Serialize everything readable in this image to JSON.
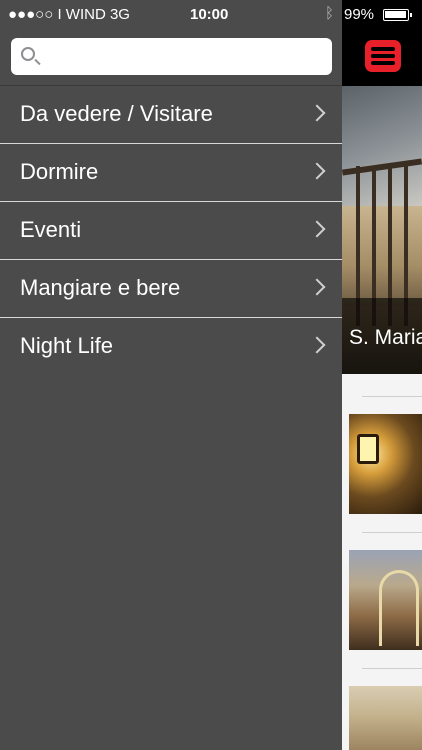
{
  "status_bar": {
    "carrier": "●●●○○ I WIND  3G",
    "time": "10:00",
    "battery_percent": "99%",
    "battery_level": 0.99
  },
  "search": {
    "placeholder": "",
    "value": ""
  },
  "menu": {
    "items": [
      {
        "label": "Da vedere / Visitare"
      },
      {
        "label": "Dormire"
      },
      {
        "label": "Eventi"
      },
      {
        "label": "Mangiare e bere"
      },
      {
        "label": "Night Life"
      }
    ]
  },
  "background_content": {
    "hero_caption": "S. Maria",
    "accent_color": "#e8202a"
  },
  "icons": [
    "bluetooth-icon",
    "battery-icon",
    "search-icon",
    "chevron-right-icon",
    "hamburger-menu-icon"
  ]
}
